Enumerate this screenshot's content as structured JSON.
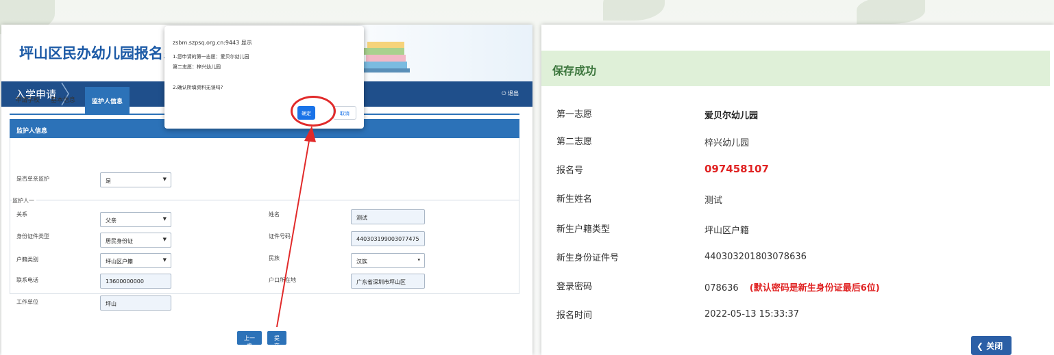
{
  "left": {
    "system_title": "坪山区民办幼儿园报名系统",
    "nav_title": "入学申请",
    "logout": "退出",
    "tabs": [
      "申请学校",
      "基本信息",
      "监护人信息"
    ],
    "section_title": "监护人信息",
    "single_parent": {
      "label": "是否单亲监护",
      "value": "是"
    },
    "guardian_legend": "监护人一",
    "fields": {
      "relation": {
        "label": "关系",
        "value": "父亲"
      },
      "id_type": {
        "label": "身份证件类型",
        "value": "居民身份证"
      },
      "hukou_type": {
        "label": "户籍类别",
        "value": "坪山区户籍"
      },
      "phone": {
        "label": "联系电话",
        "value": "13600000000"
      },
      "work": {
        "label": "工作单位",
        "value": "坪山"
      },
      "name": {
        "label": "姓名",
        "value": "测试"
      },
      "id_no": {
        "label": "证件号码",
        "value": "440303199003077475"
      },
      "ethnic": {
        "label": "民族",
        "value": "汉族"
      },
      "hukou_addr": {
        "label": "户口所在地",
        "value": "广东省深圳市坪山区"
      }
    },
    "prev_button": "上一步",
    "submit_button": "提交"
  },
  "dialog": {
    "host": "zsbm.szpsq.org.cn:9443 显示",
    "line1": "1.您申请的第一志愿：爱贝尔幼儿园",
    "line2": "第二志愿：梓兴幼儿园",
    "line3": "2.确认所填资料无误吗?",
    "ok": "确定",
    "cancel": "取消"
  },
  "right": {
    "success": "保存成功",
    "rows": [
      {
        "label": "第一志愿",
        "value": "爱贝尔幼儿园"
      },
      {
        "label": "第二志愿",
        "value": "梓兴幼儿园"
      },
      {
        "label": "报名号",
        "value": "097458107"
      },
      {
        "label": "新生姓名",
        "value": "测试"
      },
      {
        "label": "新生户籍类型",
        "value": "坪山区户籍"
      },
      {
        "label": "新生身份证件号",
        "value": "440303201803078636"
      },
      {
        "label": "登录密码",
        "value": "078636"
      },
      {
        "label": "报名时间",
        "value": "2022-05-13 15:33:37"
      }
    ],
    "password_note": "(默认密码是新生身份证最后6位)",
    "close_button": "关闭"
  },
  "colors": {
    "brand": "#1f4f8b",
    "accent": "#2c72b8",
    "success_bg": "#dff0d8",
    "alert_red": "#e02323"
  }
}
